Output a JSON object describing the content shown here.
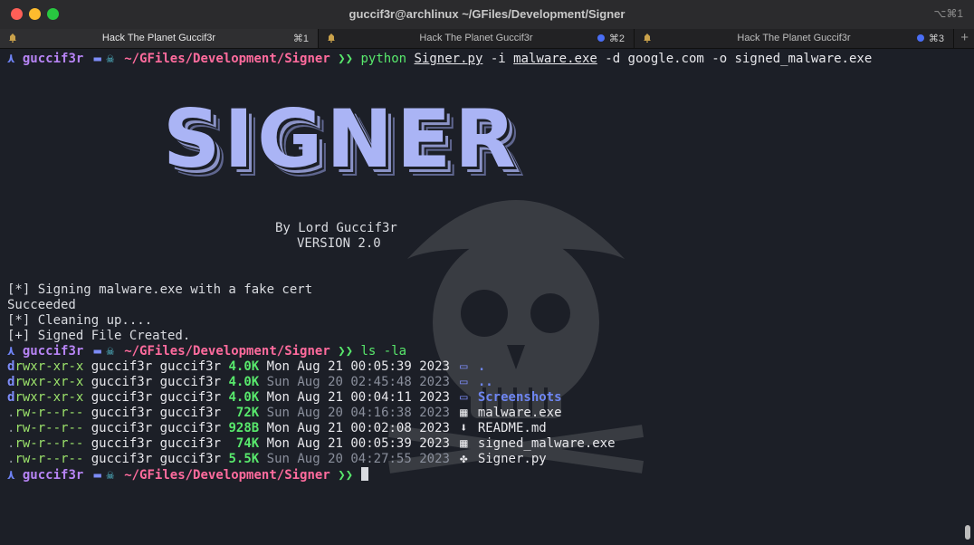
{
  "window": {
    "title": "guccif3r@archlinux ~/GFiles/Development/Signer",
    "shortcut": "⌥⌘1"
  },
  "tabs": [
    {
      "label": "Hack The Planet Guccif3r",
      "key": "⌘1"
    },
    {
      "label": "Hack The Planet Guccif3r",
      "key": "⌘2"
    },
    {
      "label": "Hack The Planet Guccif3r",
      "key": "⌘3"
    }
  ],
  "tab_add": "+",
  "prompt": {
    "symbol": "⋏",
    "user": "guccif3r",
    "path": "~/GFiles/Development/Signer",
    "arrows": "❯❯"
  },
  "command1": {
    "program": "python",
    "script": "Signer.py",
    "arg_i": "-i",
    "input": "malware.exe",
    "arg_rest": "-d google.com -o signed_malware.exe"
  },
  "banner": {
    "text": "SIGNER",
    "author": "By Lord Guccif3r",
    "version": "VERSION 2.0"
  },
  "output": {
    "line1": "[*] Signing malware.exe with a fake cert",
    "line2": "Succeeded",
    "line3": "[*] Cleaning up....",
    "line4": "[+] Signed File Created."
  },
  "command2": "ls -la",
  "listing": [
    {
      "perm_type": "d",
      "perm_rest": "rwxr-xr-x",
      "user": "guccif3r",
      "group": "guccif3r",
      "size": "4.0K",
      "date": "Mon Aug 21 00:05:39 2023",
      "icon": "folder-icon",
      "name": "."
    },
    {
      "perm_type": "d",
      "perm_rest": "rwxr-xr-x",
      "user": "guccif3r",
      "group": "guccif3r",
      "size": "4.0K",
      "date": "Sun Aug 20 02:45:48 2023",
      "icon": "folder-icon",
      "name": ".."
    },
    {
      "perm_type": "d",
      "perm_rest": "rwxr-xr-x",
      "user": "guccif3r",
      "group": "guccif3r",
      "size": "4.0K",
      "date": "Mon Aug 21 00:04:11 2023",
      "icon": "folder-icon",
      "name": "Screenshots"
    },
    {
      "perm_type": ".",
      "perm_rest": "rw-r--r--",
      "user": "guccif3r",
      "group": "guccif3r",
      "size": "72K",
      "date": "Sun Aug 20 04:16:38 2023",
      "icon": "windows-icon",
      "name": "malware.exe"
    },
    {
      "perm_type": ".",
      "perm_rest": "rw-r--r--",
      "user": "guccif3r",
      "group": "guccif3r",
      "size": "928B",
      "date": "Mon Aug 21 00:02:08 2023",
      "icon": "download-icon",
      "name": "README.md"
    },
    {
      "perm_type": ".",
      "perm_rest": "rw-r--r--",
      "user": "guccif3r",
      "group": "guccif3r",
      "size": "74K",
      "date": "Mon Aug 21 00:05:39 2023",
      "icon": "windows-icon",
      "name": "signed_malware.exe"
    },
    {
      "perm_type": ".",
      "perm_rest": "rw-r--r--",
      "user": "guccif3r",
      "group": "guccif3r",
      "size": "5.5K",
      "date": "Sun Aug 20 04:27:55 2023",
      "icon": "python-icon",
      "name": "Signer.py"
    }
  ],
  "colors": {
    "accent": "#7d8cf7",
    "user": "#b784f5",
    "path": "#ff6b9d",
    "arrows": "#58e86c",
    "background": "#1c1f27"
  }
}
